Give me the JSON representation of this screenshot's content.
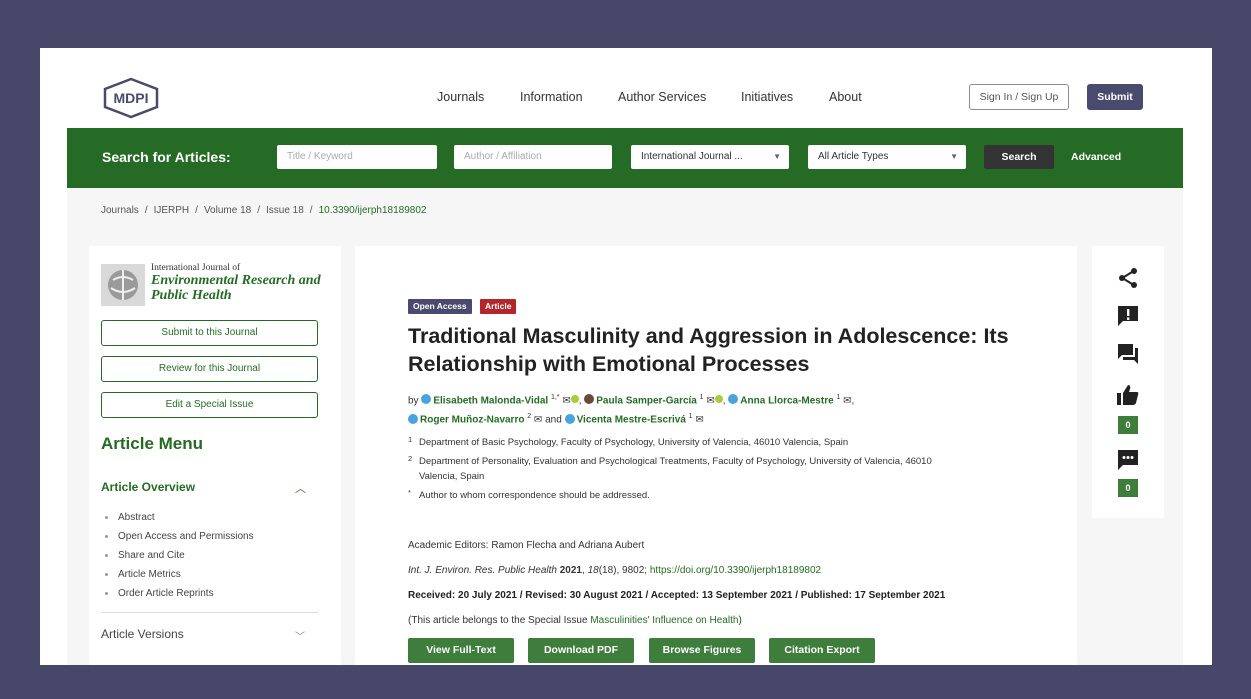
{
  "header": {
    "logo_text": "MDPI",
    "nav": [
      "Journals",
      "Information",
      "Author Services",
      "Initiatives",
      "About"
    ],
    "signin_label": "Sign In / Sign Up",
    "submit_label": "Submit"
  },
  "search": {
    "label": "Search for Articles:",
    "title_placeholder": "Title / Keyword",
    "author_placeholder": "Author / Affiliation",
    "journal_value": "International Journal ...",
    "type_value": "All Article Types",
    "search_label": "Search",
    "advanced_label": "Advanced"
  },
  "breadcrumb": [
    "Journals",
    "IJERPH",
    "Volume 18",
    "Issue 18",
    "10.3390/ijerph18189802"
  ],
  "sidebar": {
    "journal_small": "International Journal of",
    "journal_big": "Environmental Research and Public Health",
    "buttons": [
      "Submit to this Journal",
      "Review for this Journal",
      "Edit a Special Issue"
    ],
    "menu_title": "Article Menu",
    "overview_title": "Article Overview",
    "overview_items": [
      "Abstract",
      "Open Access and Permissions",
      "Share and Cite",
      "Article Metrics",
      "Order Article Reprints"
    ],
    "versions_label": "Article Versions"
  },
  "article": {
    "badge_open": "Open Access",
    "badge_type": "Article",
    "title": "Traditional Masculinity and Aggression in Adolescence: Its Relationship with Emotional Processes",
    "by": "by",
    "authors": [
      {
        "name": "Elisabeth Malonda-Vidal",
        "sup": "1,*"
      },
      {
        "name": "Paula Samper-García",
        "sup": "1"
      },
      {
        "name": "Anna Llorca-Mestre",
        "sup": "1"
      },
      {
        "name": "Roger Muñoz-Navarro",
        "sup": "2"
      },
      {
        "name": "Vicenta Mestre-Escrivá",
        "sup": "1"
      }
    ],
    "and": "and",
    "affiliations": [
      {
        "num": "1",
        "text": "Department of Basic Psychology, Faculty of Psychology, University of Valencia, 46010 Valencia, Spain"
      },
      {
        "num": "2",
        "text": "Department of Personality, Evaluation and Psychological Treatments, Faculty of Psychology, University of Valencia, 46010",
        "text2": "Valencia, Spain"
      },
      {
        "num": "*",
        "text": "Author to whom correspondence should be addressed."
      }
    ],
    "editors": "Academic Editors: Ramon Flecha and Adriana Aubert",
    "cite_journal": "Int. J. Environ. Res. Public Health",
    "cite_year": "2021",
    "cite_vol": "18",
    "cite_rest": "(18), 9802;",
    "cite_doi": "https://doi.org/10.3390/ijerph18189802",
    "dates": "Received: 20 July 2021 / Revised: 30 August 2021 / Accepted: 13 September 2021 / Published: 17 September 2021",
    "special_prefix": "(This article belongs to the Special Issue",
    "special_link": "Masculinities' Influence on Health",
    "special_suffix": ")",
    "buttons": [
      "View Full-Text",
      "Download PDF",
      "Browse Figures",
      "Citation Export"
    ]
  },
  "rail": {
    "like_count": "0",
    "comment_count": "0"
  },
  "colors": {
    "brand_green": "#266b25",
    "button_green": "#3f7d3c",
    "navy": "#4a4a6e",
    "badge_open": "#4a4a6e",
    "badge_article": "#b3262c"
  }
}
